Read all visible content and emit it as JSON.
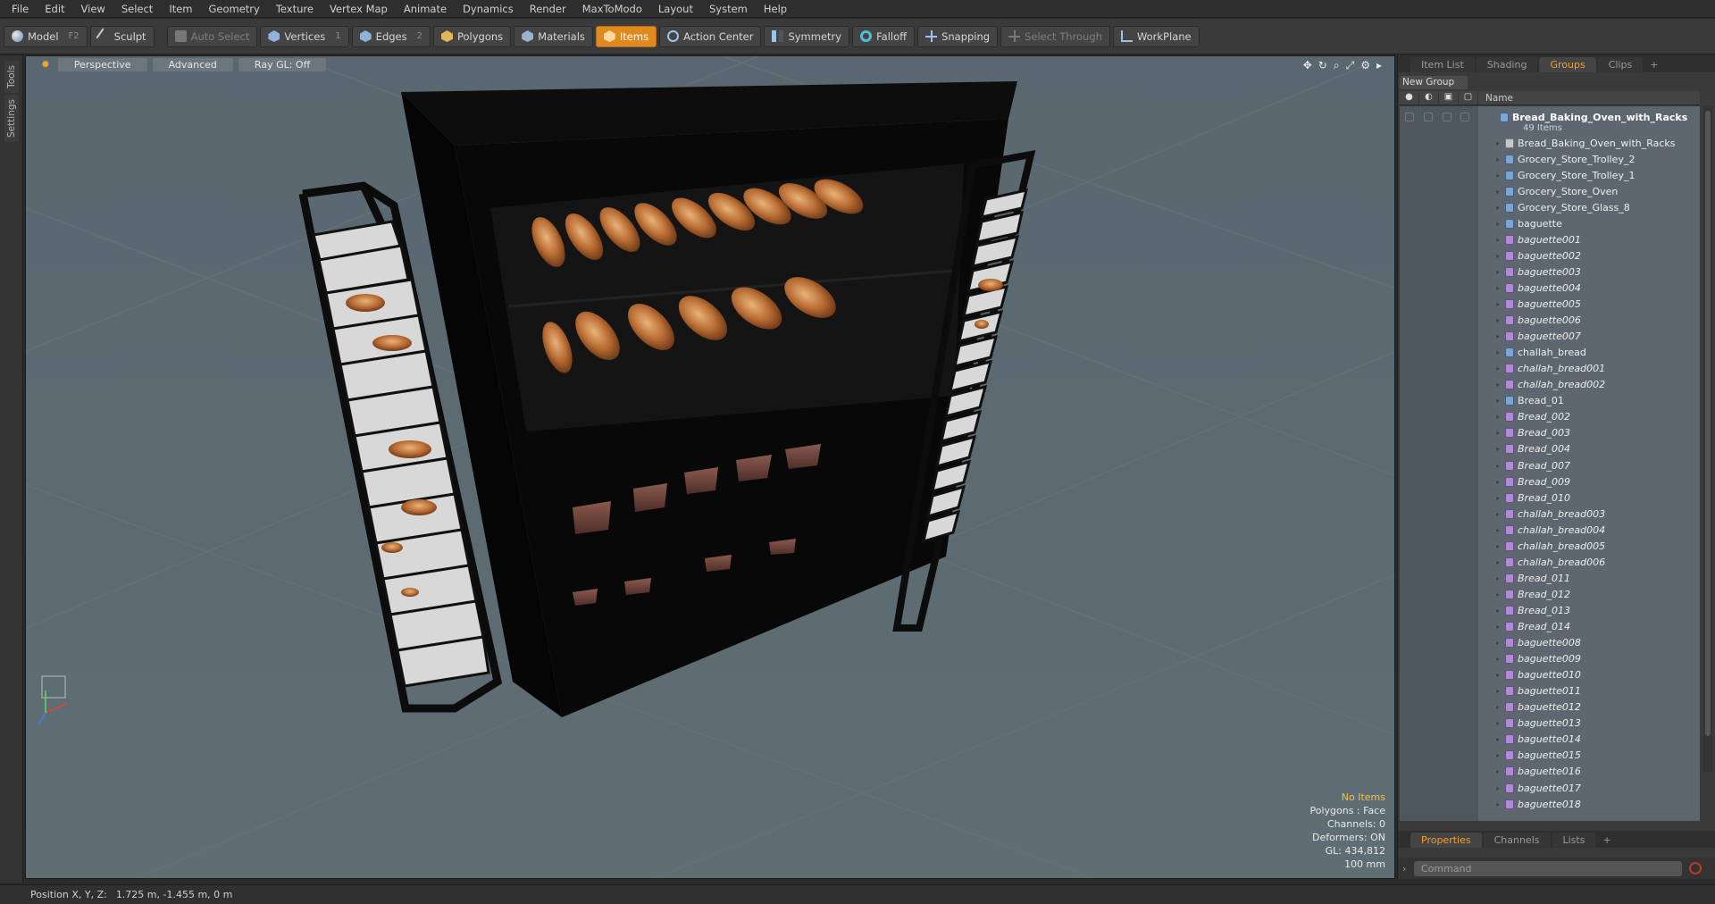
{
  "menu": [
    "File",
    "Edit",
    "View",
    "Select",
    "Item",
    "Geometry",
    "Texture",
    "Vertex Map",
    "Animate",
    "Dynamics",
    "Render",
    "MaxToModo",
    "Layout",
    "System",
    "Help"
  ],
  "toolbar": {
    "model": {
      "label": "Model",
      "key": "F2"
    },
    "sculpt": {
      "label": "Sculpt"
    },
    "auto_select": {
      "label": "Auto Select"
    },
    "vertices": {
      "label": "Vertices",
      "key": "1"
    },
    "edges": {
      "label": "Edges",
      "key": "2"
    },
    "polygons": {
      "label": "Polygons"
    },
    "materials": {
      "label": "Materials"
    },
    "items": {
      "label": "Items"
    },
    "action_center": {
      "label": "Action Center"
    },
    "symmetry": {
      "label": "Symmetry"
    },
    "falloff": {
      "label": "Falloff"
    },
    "snapping": {
      "label": "Snapping"
    },
    "select_through": {
      "label": "Select Through"
    },
    "workplane": {
      "label": "WorkPlane"
    }
  },
  "left_strip": {
    "tools": "Tools",
    "settings": "Settings"
  },
  "viewport": {
    "view_mode": "Perspective",
    "shading": "Advanced",
    "raygl": "Ray GL: Off",
    "info": {
      "selection": "No Items",
      "polygons": "Polygons : Face",
      "channels": "Channels: 0",
      "deformers": "Deformers: ON",
      "gl": "GL: 434,812",
      "scale": "100 mm"
    }
  },
  "panel": {
    "tabs": [
      "Item List",
      "Shading",
      "Groups",
      "Clips"
    ],
    "active_tab": "Groups",
    "new_group": "New Group",
    "column_name": "Name",
    "group": {
      "name": "Bread_Baking_Oven_with_Racks",
      "count": "49 Items"
    },
    "items": [
      {
        "name": "Bread_Baking_Oven_with_Racks",
        "type": "loc",
        "italic": false
      },
      {
        "name": "Grocery_Store_Trolley_2",
        "type": "mesh",
        "italic": false
      },
      {
        "name": "Grocery_Store_Trolley_1",
        "type": "mesh",
        "italic": false
      },
      {
        "name": "Grocery_Store_Oven",
        "type": "mesh",
        "italic": false
      },
      {
        "name": "Grocery_Store_Glass_8",
        "type": "mesh",
        "italic": false
      },
      {
        "name": "baguette",
        "type": "mesh",
        "italic": false
      },
      {
        "name": "baguette001",
        "type": "inst",
        "italic": true
      },
      {
        "name": "baguette002",
        "type": "inst",
        "italic": true
      },
      {
        "name": "baguette003",
        "type": "inst",
        "italic": true
      },
      {
        "name": "baguette004",
        "type": "inst",
        "italic": true
      },
      {
        "name": "baguette005",
        "type": "inst",
        "italic": true
      },
      {
        "name": "baguette006",
        "type": "inst",
        "italic": true
      },
      {
        "name": "baguette007",
        "type": "inst",
        "italic": true
      },
      {
        "name": "challah_bread",
        "type": "mesh",
        "italic": false
      },
      {
        "name": "challah_bread001",
        "type": "inst",
        "italic": true
      },
      {
        "name": "challah_bread002",
        "type": "inst",
        "italic": true
      },
      {
        "name": "Bread_01",
        "type": "mesh",
        "italic": false
      },
      {
        "name": "Bread_002",
        "type": "inst",
        "italic": true
      },
      {
        "name": "Bread_003",
        "type": "inst",
        "italic": true
      },
      {
        "name": "Bread_004",
        "type": "inst",
        "italic": true
      },
      {
        "name": "Bread_007",
        "type": "inst",
        "italic": true
      },
      {
        "name": "Bread_009",
        "type": "inst",
        "italic": true
      },
      {
        "name": "Bread_010",
        "type": "inst",
        "italic": true
      },
      {
        "name": "challah_bread003",
        "type": "inst",
        "italic": true
      },
      {
        "name": "challah_bread004",
        "type": "inst",
        "italic": true
      },
      {
        "name": "challah_bread005",
        "type": "inst",
        "italic": true
      },
      {
        "name": "challah_bread006",
        "type": "inst",
        "italic": true
      },
      {
        "name": "Bread_011",
        "type": "inst",
        "italic": true
      },
      {
        "name": "Bread_012",
        "type": "inst",
        "italic": true
      },
      {
        "name": "Bread_013",
        "type": "inst",
        "italic": true
      },
      {
        "name": "Bread_014",
        "type": "inst",
        "italic": true
      },
      {
        "name": "baguette008",
        "type": "inst",
        "italic": true
      },
      {
        "name": "baguette009",
        "type": "inst",
        "italic": true
      },
      {
        "name": "baguette010",
        "type": "inst",
        "italic": true
      },
      {
        "name": "baguette011",
        "type": "inst",
        "italic": true
      },
      {
        "name": "baguette012",
        "type": "inst",
        "italic": true
      },
      {
        "name": "baguette013",
        "type": "inst",
        "italic": true
      },
      {
        "name": "baguette014",
        "type": "inst",
        "italic": true
      },
      {
        "name": "baguette015",
        "type": "inst",
        "italic": true
      },
      {
        "name": "baguette016",
        "type": "inst",
        "italic": true
      },
      {
        "name": "baguette017",
        "type": "inst",
        "italic": true
      },
      {
        "name": "baguette018",
        "type": "inst",
        "italic": true
      }
    ],
    "bottom_tabs": [
      "Properties",
      "Channels",
      "Lists"
    ],
    "bottom_active": "Properties",
    "command_placeholder": "Command"
  },
  "status": {
    "label": "Position X, Y, Z:",
    "value": "1.725 m, -1.455 m, 0 m"
  },
  "colors": {
    "accent": "#e08a1e",
    "viewport_bg": "#5b6a73",
    "panel_bg": "#3a3a3a"
  }
}
